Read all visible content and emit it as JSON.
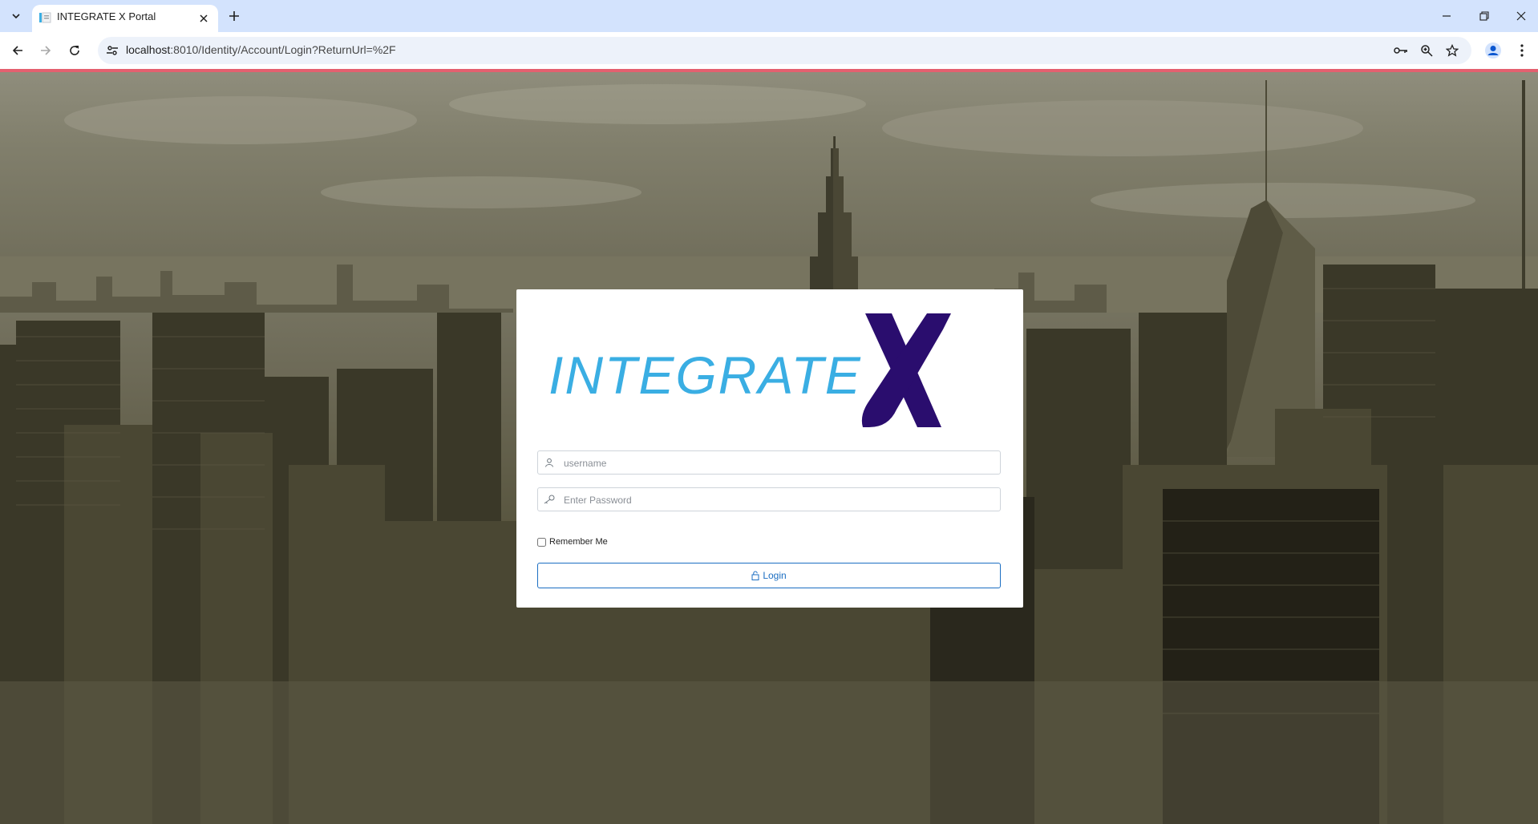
{
  "browser": {
    "tab_title": "INTEGRATE X Portal",
    "url_host": "localhost",
    "url_path": ":8010/Identity/Account/Login?ReturnUrl=%2F",
    "icons": [
      "tab-list-icon",
      "favicon",
      "close-icon",
      "plus-icon",
      "minimize-icon",
      "restore-icon",
      "window-close-icon",
      "back-icon",
      "forward-icon",
      "reload-icon",
      "site-info-icon",
      "key-icon",
      "zoom-icon",
      "star-icon",
      "profile-icon",
      "kebab-menu-icon"
    ]
  },
  "login": {
    "logo_text": "INTEGRATE",
    "logo_mark": "X",
    "username_placeholder": "username",
    "password_placeholder": "Enter Password",
    "remember_label": "Remember Me",
    "remember_checked": false,
    "login_label": "Login"
  },
  "colors": {
    "tabbar": "#d3e3fd",
    "loading_bar": "#e4606f",
    "logo_blue": "#3aaee3",
    "logo_x": "#2a0d6e",
    "login_accent": "#1b6ec2"
  }
}
